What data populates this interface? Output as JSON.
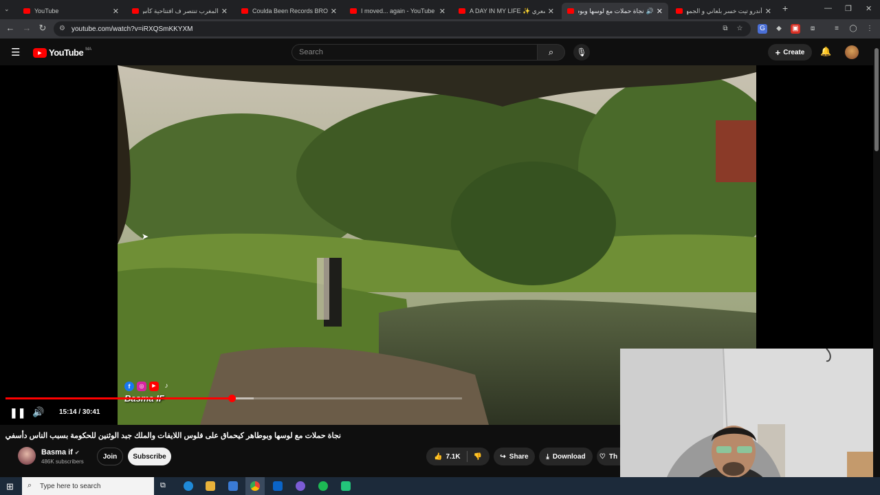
{
  "tabs": [
    {
      "title": "YouTube",
      "active": false
    },
    {
      "title": "المغرب تنتصر ف افتتاحية كأس الأ",
      "active": false
    },
    {
      "title": "Coulda Been Records BROOKLYN",
      "active": false
    },
    {
      "title": "I moved... again - YouTube",
      "active": false
    },
    {
      "title": "A DAY IN MY LIFE ✨ نعت شعري",
      "active": false
    },
    {
      "title": "نجاة حملات مع لوسها وبوطاه",
      "active": true
    },
    {
      "title": "أندرو تيت خسر بلعاني و الجمهور",
      "active": false
    }
  ],
  "address": {
    "url": "youtube.com/watch?v=iRXQSmKKYXM"
  },
  "youtube": {
    "logo_text": "YouTube",
    "country_code": "MA",
    "search_placeholder": "Search",
    "create_label": "Create"
  },
  "player": {
    "time_display": "15:14 / 30:41",
    "progress_fraction": 0.496,
    "buffered_fraction": 0.543,
    "watermark": "Basma IF"
  },
  "video": {
    "title": "نجاة حملات مع لوسها وبوطاهر كيحماق على فلوس اللايفات والملك جبد الوثنين للحكومة بسبب الناس دأسفي",
    "channel_name": "Basma if",
    "subscribers": "486K subscribers",
    "join_label": "Join",
    "subscribe_label": "Subscribe",
    "likes": "7.1K",
    "share_label": "Share",
    "download_label": "Download",
    "thanks_label": "Th"
  },
  "taskbar": {
    "search_placeholder": "Type here to search"
  },
  "colors": {
    "youtube_red": "#ff0000",
    "background": "#0f0f0f",
    "chrome_dark": "#202124"
  }
}
